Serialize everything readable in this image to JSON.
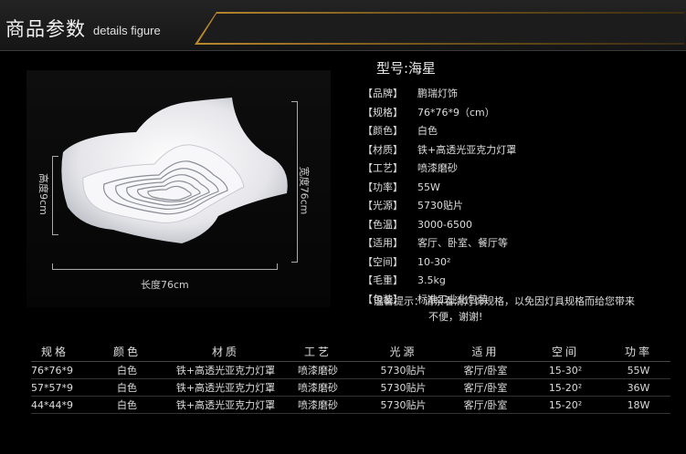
{
  "header": {
    "title_cn": "商品参数",
    "title_en": "details figure"
  },
  "figure": {
    "height_label": "高度9cm",
    "width_label": "宽度76cm",
    "length_label": "长度76cm"
  },
  "model": "型号:海星",
  "specs": [
    {
      "label": "【品牌】",
      "value": "鹏瑞灯饰"
    },
    {
      "label": "【规格】",
      "value": "76*76*9（cm）"
    },
    {
      "label": "【颜色】",
      "value": "白色"
    },
    {
      "label": "【材质】",
      "value": "铁+高透光亚克力灯罩"
    },
    {
      "label": "【工艺】",
      "value": "喷漆磨砂"
    },
    {
      "label": "【功率】",
      "value": "55W"
    },
    {
      "label": "【光源】",
      "value": "5730贴片"
    },
    {
      "label": "【色温】",
      "value": "3000-6500"
    },
    {
      "label": "【适用】",
      "value": "客厅、卧室、餐厅等"
    },
    {
      "label": "【空间】",
      "value": "10-30²"
    },
    {
      "label": "【毛重】",
      "value": "3.5kg"
    },
    {
      "label": "【包装】",
      "value": "标准工业化包装"
    }
  ],
  "note": {
    "line1": "温馨提示：请亲看清灯饰规格，以免因灯具规格而给您带来",
    "line2": "不便，谢谢!"
  },
  "table": {
    "headers": [
      "规格",
      "颜色",
      "材质",
      "工艺",
      "光源",
      "适用",
      "空间",
      "功率"
    ],
    "rows": [
      [
        "76*76*9",
        "白色",
        "铁+高透光亚克力灯罩",
        "喷漆磨砂",
        "5730贴片",
        "客厅/卧室",
        "15-30²",
        "55W"
      ],
      [
        "57*57*9",
        "白色",
        "铁+高透光亚克力灯罩",
        "喷漆磨砂",
        "5730贴片",
        "客厅/卧室",
        "15-20²",
        "36W"
      ],
      [
        "44*44*9",
        "白色",
        "铁+高透光亚克力灯罩",
        "喷漆磨砂",
        "5730贴片",
        "客厅/卧室",
        "15-20²",
        "18W"
      ]
    ]
  },
  "colors": {
    "gold": "#b8892f",
    "background": "#000000"
  }
}
